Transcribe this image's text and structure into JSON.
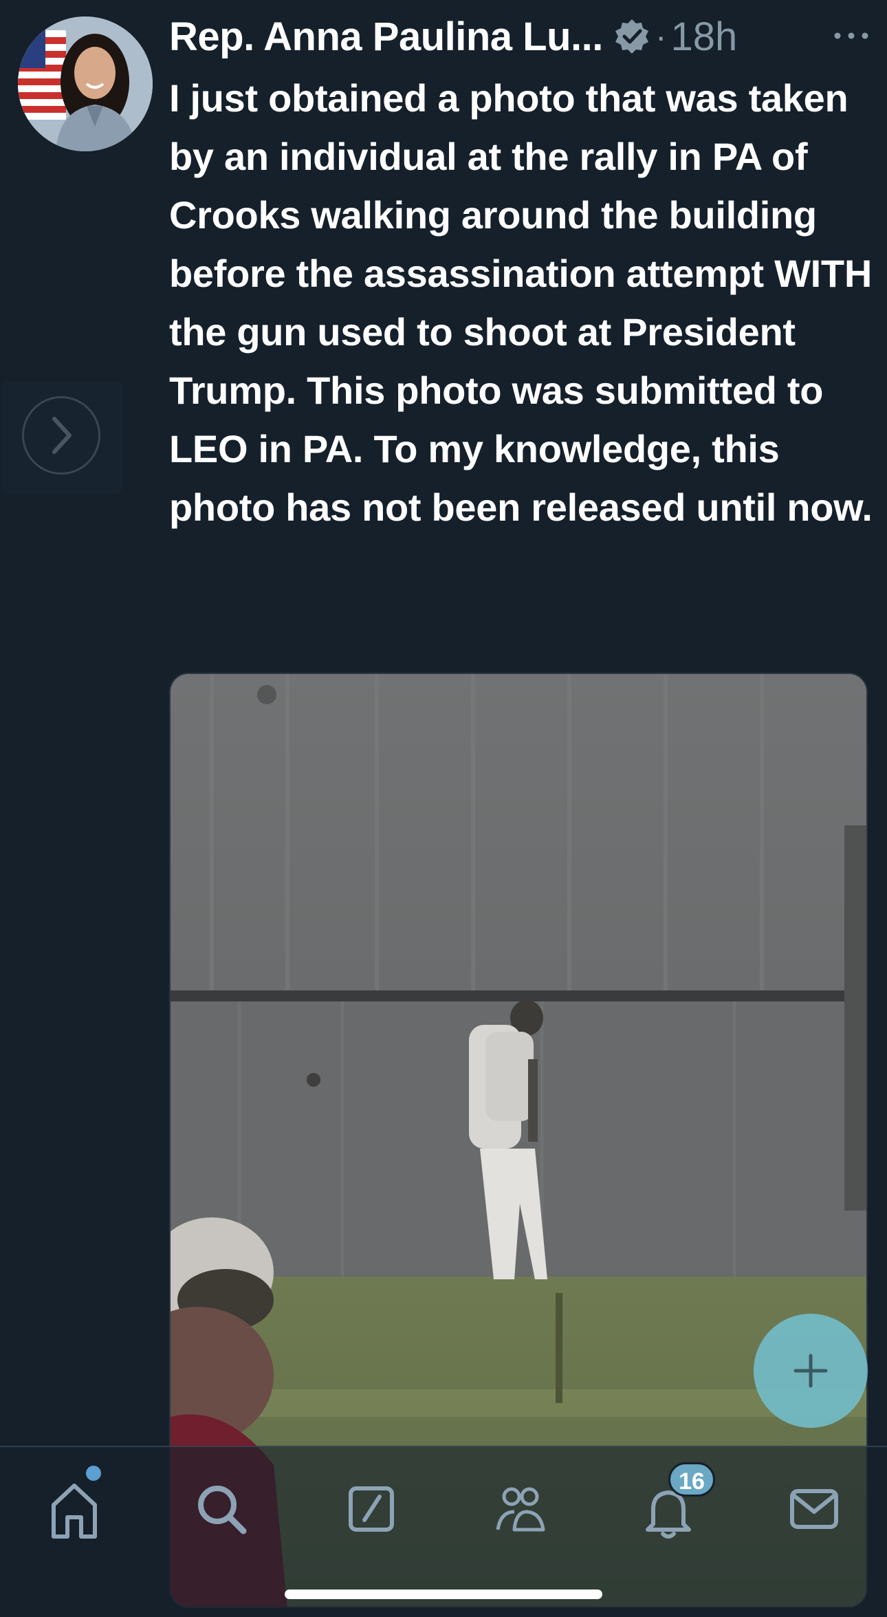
{
  "tweet": {
    "author_name": "Rep. Anna Paulina Lu...",
    "separator": "·",
    "timestamp": "18h",
    "text": "I just obtained a photo that was taken by an individual at the rally in PA of Crooks walking around the building before the assassination attempt WITH the gun used to shoot at President Trump. This photo was submitted to LEO in PA. To my knowledge, this photo has not been released until now."
  },
  "icons": {
    "verified": "verified-badge-icon",
    "more": "more-options-icon",
    "expand": "chevron-right-icon",
    "compose": "plus-icon"
  },
  "nav": {
    "items": [
      {
        "name": "home",
        "icon": "home-icon"
      },
      {
        "name": "search",
        "icon": "search-icon"
      },
      {
        "name": "grok",
        "icon": "grok-icon"
      },
      {
        "name": "communities",
        "icon": "people-icon"
      },
      {
        "name": "notifications",
        "icon": "bell-icon"
      },
      {
        "name": "messages",
        "icon": "mail-icon"
      }
    ],
    "notifications_badge": "16"
  },
  "colors": {
    "background": "#15202b",
    "text_primary": "#ffffff",
    "text_secondary": "#8899a6",
    "badge": "#6aa8c4",
    "fab": "#73becd"
  }
}
